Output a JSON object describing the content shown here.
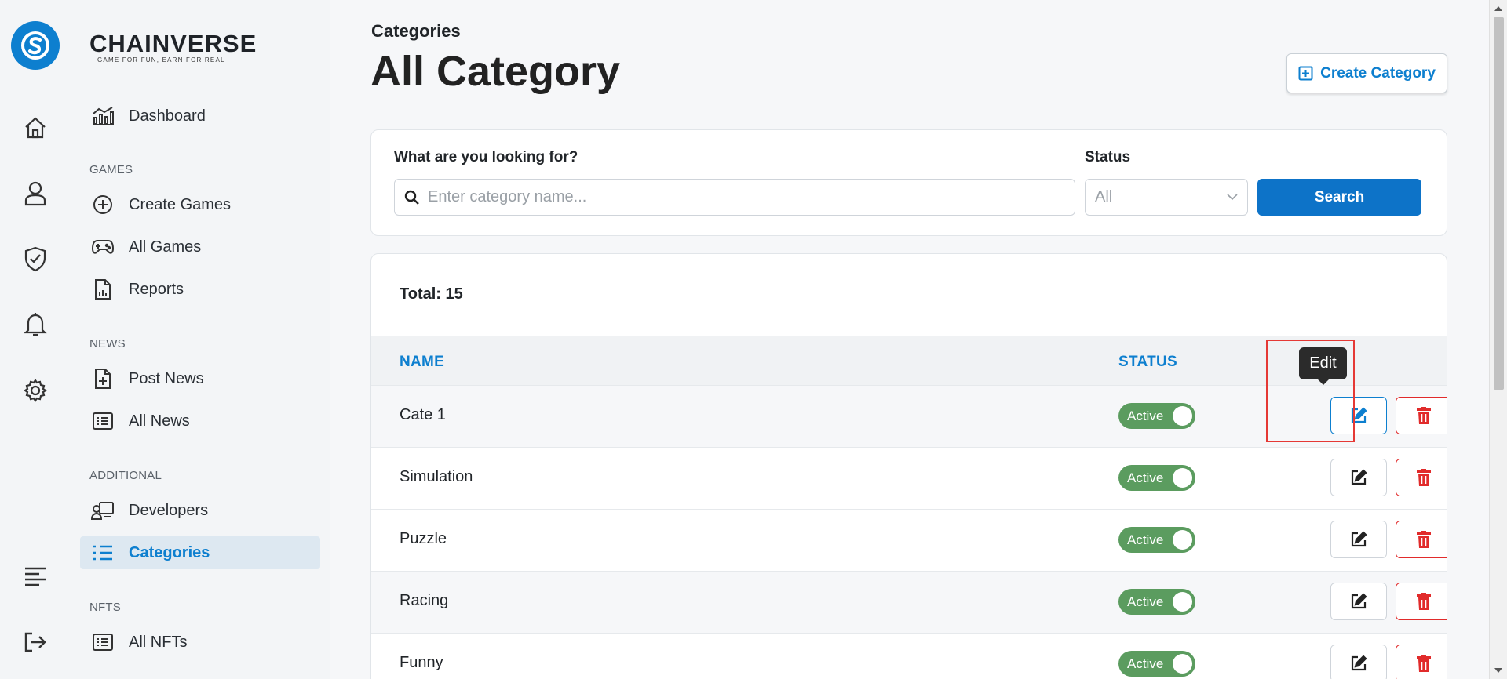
{
  "brand": {
    "name": "CHAINVERSE",
    "tagline": "GAME FOR FUN, EARN FOR REAL"
  },
  "sidebar": {
    "dashboard": "Dashboard",
    "sections": {
      "games": "GAMES",
      "news": "NEWS",
      "additional": "ADDITIONAL",
      "nfts": "NFTS"
    },
    "items": {
      "create_games": "Create Games",
      "all_games": "All Games",
      "reports": "Reports",
      "post_news": "Post News",
      "all_news": "All News",
      "developers": "Developers",
      "categories": "Categories",
      "all_nfts": "All NFTs"
    }
  },
  "header": {
    "breadcrumb": "Categories",
    "title": "All Category",
    "create_label": "Create Category"
  },
  "filter": {
    "search_label": "What are you looking for?",
    "search_placeholder": "Enter category name...",
    "status_label": "Status",
    "status_value": "All",
    "search_button": "Search"
  },
  "table": {
    "total": "Total: 15",
    "columns": {
      "name": "NAME",
      "status": "STATUS"
    },
    "rows": [
      {
        "name": "Cate 1",
        "status": "Active"
      },
      {
        "name": "Simulation",
        "status": "Active"
      },
      {
        "name": "Puzzle",
        "status": "Active"
      },
      {
        "name": "Racing",
        "status": "Active"
      },
      {
        "name": "Funny",
        "status": "Active"
      }
    ]
  },
  "tooltip": "Edit",
  "colors": {
    "accent": "#0d7fcf",
    "active_toggle": "#5b9c5f",
    "danger": "#e12b2b",
    "highlight": "#e53935"
  }
}
